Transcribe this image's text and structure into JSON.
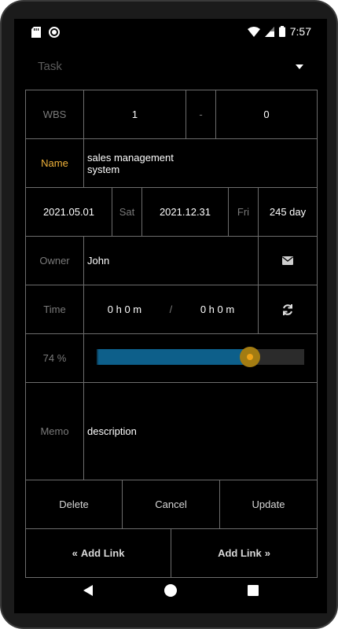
{
  "status_bar": {
    "time": "7:57",
    "icons_left": [
      "sd-card-icon",
      "record-icon"
    ],
    "icons_right": [
      "wifi-icon",
      "signal-icon",
      "battery-icon"
    ]
  },
  "header": {
    "title": "Task"
  },
  "wbs": {
    "label": "WBS",
    "major": "1",
    "separator": "-",
    "minor": "0"
  },
  "name": {
    "label": "Name",
    "value_line1": "sales management",
    "value_line2": "system"
  },
  "dates": {
    "start": "2021.05.01",
    "start_day": "Sat",
    "end": "2021.12.31",
    "end_day": "Fri",
    "duration": "245 day"
  },
  "owner": {
    "label": "Owner",
    "value": "John"
  },
  "time": {
    "label": "Time",
    "spent": "0 h 0 m",
    "separator": "/",
    "planned": "0 h 0 m"
  },
  "progress": {
    "label": "74 %",
    "value_fraction": 0.74
  },
  "memo": {
    "label": "Memo",
    "value": "description"
  },
  "actions": {
    "delete": "Delete",
    "cancel": "Cancel",
    "update": "Update"
  },
  "links": {
    "prev": "Add Link",
    "next": "Add Link"
  },
  "colors": {
    "accent_label": "#f0b23a",
    "progress_fill": "#0d5f8a",
    "progress_thumb": "#f0a418"
  }
}
